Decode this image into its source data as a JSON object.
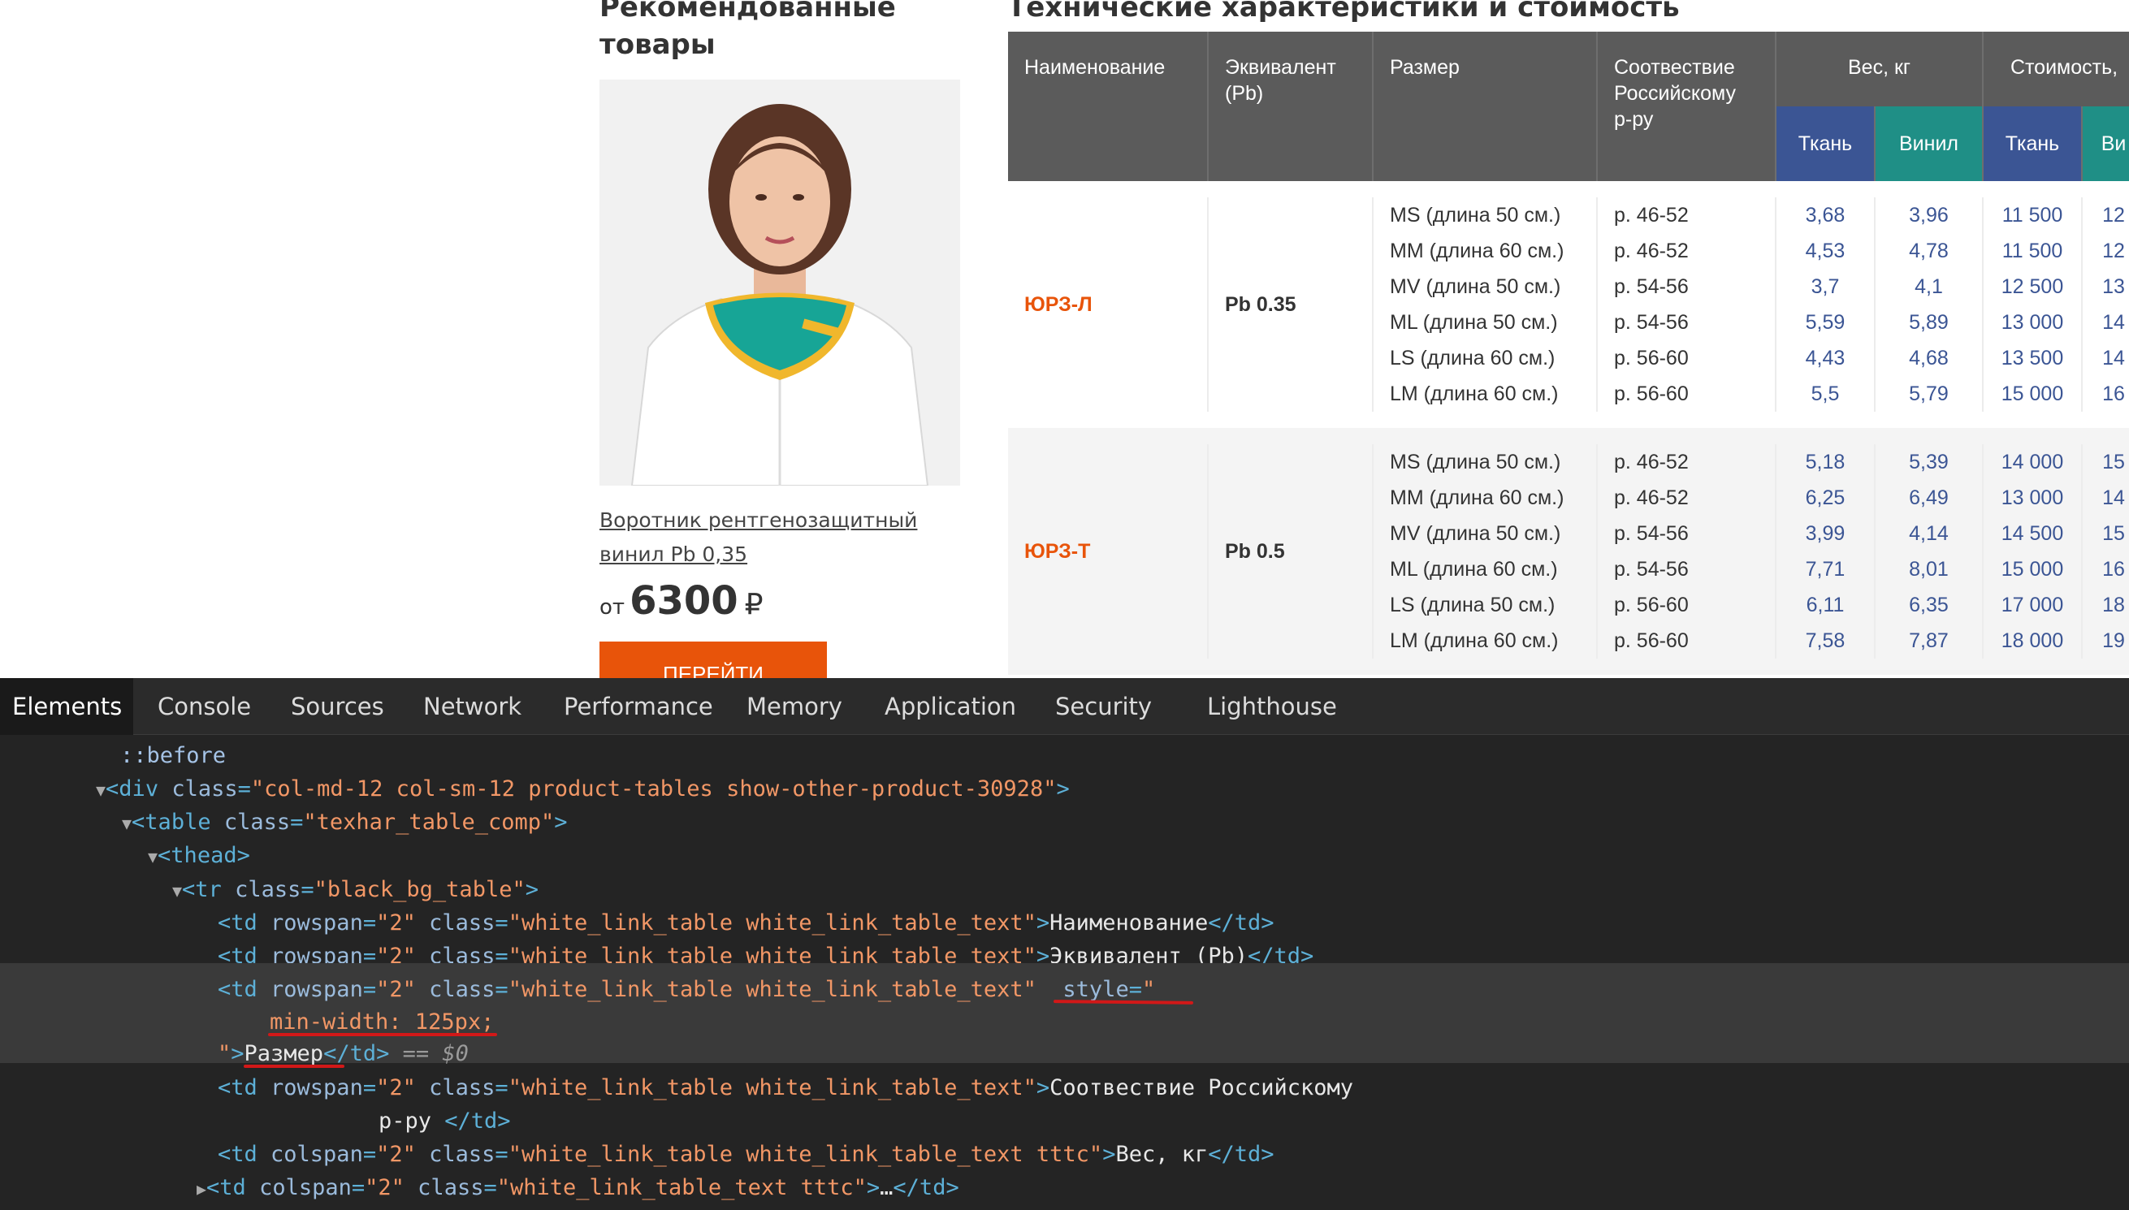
{
  "page": {
    "recommended_title": "Рекомендованные товары",
    "spec_title": "Технические характеристики и стоимость",
    "product": {
      "name": "Воротник рентгенозащитный винил Pb 0,35",
      "price_prefix": "от",
      "price": "6300",
      "currency": "₽",
      "button_label": "ПЕРЕЙТИ"
    }
  },
  "table": {
    "headers": {
      "name": "Наименование",
      "equivalent": "Эквивалент (Pb)",
      "size": "Размер",
      "compliance": "Соотвествие Российскому р-ру",
      "weight": "Вес, кг",
      "cost": "Стоимость,",
      "fabric": "Ткань",
      "vinyl": "Винил",
      "fabric2": "Ткань",
      "vinyl2": "Ви"
    },
    "groups": [
      {
        "name": "ЮРЗ-Л",
        "equivalent": "Pb 0.35",
        "rows": [
          {
            "size": "MS (длина 50 см.)",
            "ru": "р. 46-52",
            "w_fabric": "3,68",
            "w_vinyl": "3,96",
            "c_fabric": "11 500",
            "c_vinyl": "12"
          },
          {
            "size": "MM (длина 60 см.)",
            "ru": "р. 46-52",
            "w_fabric": "4,53",
            "w_vinyl": "4,78",
            "c_fabric": "11 500",
            "c_vinyl": "12"
          },
          {
            "size": "MV (длина 50 см.)",
            "ru": "р. 54-56",
            "w_fabric": "3,7",
            "w_vinyl": "4,1",
            "c_fabric": "12 500",
            "c_vinyl": "13"
          },
          {
            "size": "ML (длина 50 см.)",
            "ru": "р. 54-56",
            "w_fabric": "5,59",
            "w_vinyl": "5,89",
            "c_fabric": "13 000",
            "c_vinyl": "14"
          },
          {
            "size": "LS (длина 60 см.)",
            "ru": "р. 56-60",
            "w_fabric": "4,43",
            "w_vinyl": "4,68",
            "c_fabric": "13 500",
            "c_vinyl": "14"
          },
          {
            "size": "LM (длина 60 см.)",
            "ru": "р. 56-60",
            "w_fabric": "5,5",
            "w_vinyl": "5,79",
            "c_fabric": "15 000",
            "c_vinyl": "16"
          }
        ]
      },
      {
        "name": "ЮРЗ-Т",
        "equivalent": "Pb 0.5",
        "rows": [
          {
            "size": "MS (длина 50 см.)",
            "ru": "р. 46-52",
            "w_fabric": "5,18",
            "w_vinyl": "5,39",
            "c_fabric": "14 000",
            "c_vinyl": "15"
          },
          {
            "size": "MM (длина 60 см.)",
            "ru": "р. 46-52",
            "w_fabric": "6,25",
            "w_vinyl": "6,49",
            "c_fabric": "13 000",
            "c_vinyl": "14"
          },
          {
            "size": "MV (длина 50 см.)",
            "ru": "р. 54-56",
            "w_fabric": "3,99",
            "w_vinyl": "4,14",
            "c_fabric": "14 500",
            "c_vinyl": "15"
          },
          {
            "size": "ML (длина 60 см.)",
            "ru": "р. 54-56",
            "w_fabric": "7,71",
            "w_vinyl": "8,01",
            "c_fabric": "15 000",
            "c_vinyl": "16"
          },
          {
            "size": "LS (длина 50 см.)",
            "ru": "р. 56-60",
            "w_fabric": "6,11",
            "w_vinyl": "6,35",
            "c_fabric": "17 000",
            "c_vinyl": "18"
          },
          {
            "size": "LM (длина 60 см.)",
            "ru": "р. 56-60",
            "w_fabric": "7,58",
            "w_vinyl": "7,87",
            "c_fabric": "18 000",
            "c_vinyl": "19"
          }
        ]
      }
    ]
  },
  "devtools": {
    "tabs": [
      "Elements",
      "Console",
      "Sources",
      "Network",
      "Performance",
      "Memory",
      "Application",
      "Security",
      "Lighthouse"
    ],
    "active_tab": "Elements",
    "tree": {
      "before": "::before",
      "div_class": "\"col-md-12 col-sm-12 product-tables show-other-product-30928\"",
      "table_class": "\"texhar_table_comp\"",
      "tr_class": "\"black_bg_table\"",
      "rowspan": "\"2\"",
      "colspan": "\"2\"",
      "td_class": "\"white_link_table white_link_table_text\"",
      "td_class_tttc": "\"white_link_table white_link_table_text tttc\"",
      "td_class_tttc2": "\"white_link_table_text tttc\"",
      "style_open": "\"",
      "style_value": "min-width: 125px;",
      "style_close": "\"",
      "text_name": "Наименование",
      "text_equivalent": "Эквивалент (Pb)",
      "text_size": "Размер",
      "selected_marker": "== $0",
      "text_compliance_1": "Соотвествие Российскому",
      "text_compliance_2": "р-ру ",
      "text_weight": "Вес, кг",
      "ellipsis": "…"
    }
  },
  "colors": {
    "accent": "#e8540a",
    "header_gray": "#5b5b5b",
    "fabric_blue": "#3b5594",
    "vinyl_teal": "#1f8f86",
    "annotation_red": "#d21818"
  }
}
